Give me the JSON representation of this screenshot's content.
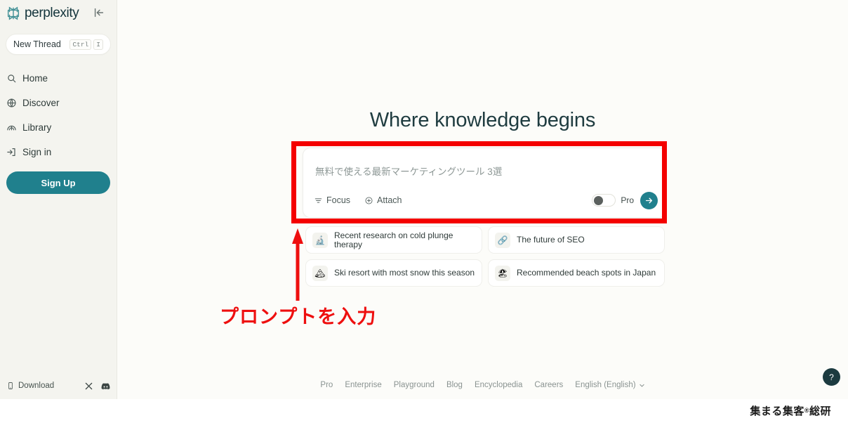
{
  "sidebar": {
    "brand": "perplexity",
    "collapse_icon": "collapse-sidebar-icon",
    "new_thread": {
      "label": "New Thread",
      "shortcut_key1": "Ctrl",
      "shortcut_key2": "I"
    },
    "nav": [
      {
        "label": "Home",
        "icon": "home-search-icon"
      },
      {
        "label": "Discover",
        "icon": "globe-icon"
      },
      {
        "label": "Library",
        "icon": "library-icon"
      },
      {
        "label": "Sign in",
        "icon": "sign-in-icon"
      }
    ],
    "signup_label": "Sign Up",
    "download_label": "Download",
    "socials": [
      {
        "name": "x-twitter-icon"
      },
      {
        "name": "discord-icon"
      }
    ]
  },
  "main": {
    "headline": "Where knowledge begins",
    "search": {
      "placeholder": "無料で使える最新マーケティングツール 3選",
      "focus_label": "Focus",
      "attach_label": "Attach",
      "pro_label": "Pro",
      "pro_enabled": false,
      "submit_icon": "arrow-right-icon"
    },
    "suggestions": [
      {
        "icon": "🔬",
        "icon_name": "microscope-icon",
        "text": "Recent research on cold plunge therapy"
      },
      {
        "icon": "🔗",
        "icon_name": "link-icon",
        "text": "The future of SEO"
      },
      {
        "icon": "🏔",
        "icon_name": "snowy-mountain-icon",
        "text": "Ski resort with most snow this season"
      },
      {
        "icon": "🏖",
        "icon_name": "beach-umbrella-icon",
        "text": "Recommended beach spots in Japan"
      }
    ],
    "footer_links": [
      "Pro",
      "Enterprise",
      "Playground",
      "Blog",
      "Encyclopedia",
      "Careers"
    ],
    "language": "English (English)",
    "help_label": "?"
  },
  "annotations": {
    "callout_text": "プロンプトを入力",
    "rect_color": "#f40000",
    "arrow_color": "#ee0f0f"
  },
  "watermark": {
    "prefix": "集まる集客",
    "mark": "®",
    "suffix": "総研"
  },
  "colors": {
    "accent_teal": "#20808d",
    "sidebar_bg": "#f4f4ef",
    "main_bg": "#fcfcf9",
    "heading": "#1f3c40",
    "annotation_red": "#f40000"
  }
}
